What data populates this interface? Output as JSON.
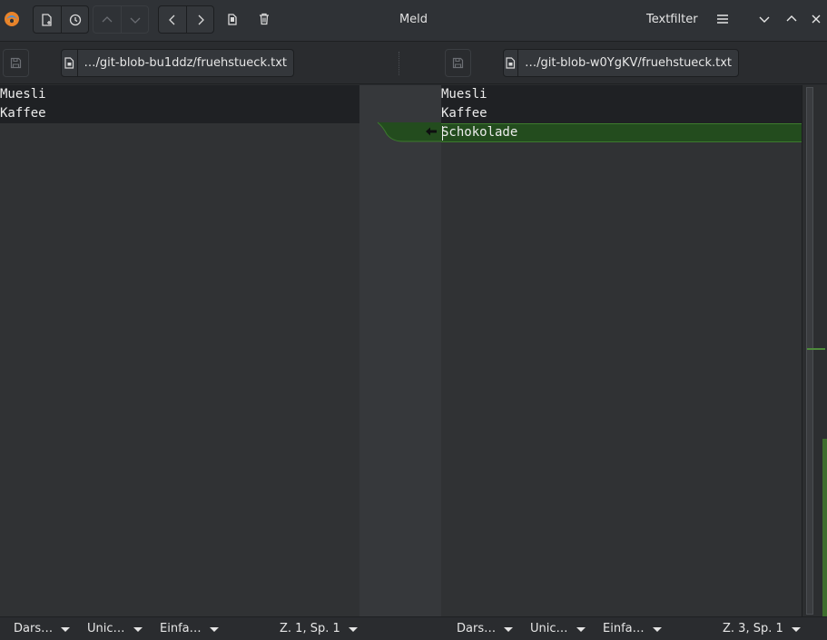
{
  "window": {
    "title": "Meld",
    "textfilter_label": "Textfilter"
  },
  "left_pane": {
    "path": "…/git-blob-bu1ddz/fruehstueck.txt",
    "lines": [
      "Muesli",
      "Kaffee"
    ]
  },
  "right_pane": {
    "path": "…/git-blob-w0YgKV/fruehstueck.txt",
    "lines": [
      "Muesli",
      "Kaffee",
      "Schokolade"
    ]
  },
  "left_status": {
    "view": "Dars…",
    "encoding": "Unic…",
    "insert_mode": "Einfa…",
    "cursor": "Z. 1, Sp. 1"
  },
  "right_status": {
    "view": "Dars…",
    "encoding": "Unic…",
    "insert_mode": "Einfa…",
    "cursor": "Z. 3, Sp. 1"
  },
  "colors": {
    "insert_highlight": "#234c1e",
    "context_background": "#1f2124",
    "accent": "#4e8a3c"
  }
}
